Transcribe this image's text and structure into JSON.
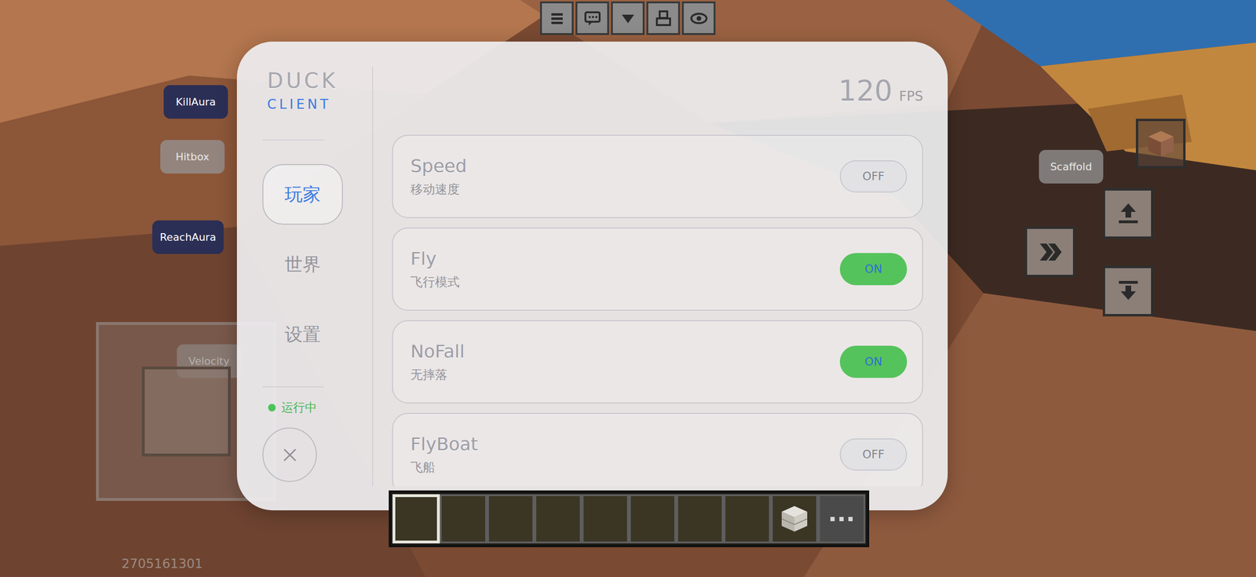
{
  "client": {
    "name": "DUCK",
    "subtitle": "CLIENT"
  },
  "fps": {
    "value": "120",
    "unit": "FPS"
  },
  "nav": [
    {
      "label": "玩家",
      "selected": true
    },
    {
      "label": "世界",
      "selected": false
    },
    {
      "label": "设置",
      "selected": false
    }
  ],
  "status": {
    "label": "运行中",
    "running": true
  },
  "modules": [
    {
      "name": "Speed",
      "desc": "移动速度",
      "on": false,
      "toggle": "OFF"
    },
    {
      "name": "Fly",
      "desc": "飞行模式",
      "on": true,
      "toggle": "ON"
    },
    {
      "name": "NoFall",
      "desc": "无摔落",
      "on": true,
      "toggle": "ON"
    },
    {
      "name": "FlyBoat",
      "desc": "飞船",
      "on": false,
      "toggle": "OFF"
    }
  ],
  "hud_buttons": [
    {
      "label": "KillAura",
      "on": true
    },
    {
      "label": "Hitbox",
      "on": false
    },
    {
      "label": "ReachAura",
      "on": true
    },
    {
      "label": "Velocity",
      "on": false
    },
    {
      "label": "Scaffold",
      "on": false
    }
  ],
  "hotbar": [
    {
      "selected": true,
      "item": "none"
    },
    {
      "selected": false,
      "item": "none"
    },
    {
      "selected": false,
      "item": "none"
    },
    {
      "selected": false,
      "item": "none"
    },
    {
      "selected": false,
      "item": "none"
    },
    {
      "selected": false,
      "item": "none"
    },
    {
      "selected": false,
      "item": "none"
    },
    {
      "selected": false,
      "item": "none"
    },
    {
      "selected": false,
      "item": "block"
    }
  ],
  "player_id": "2705161301"
}
